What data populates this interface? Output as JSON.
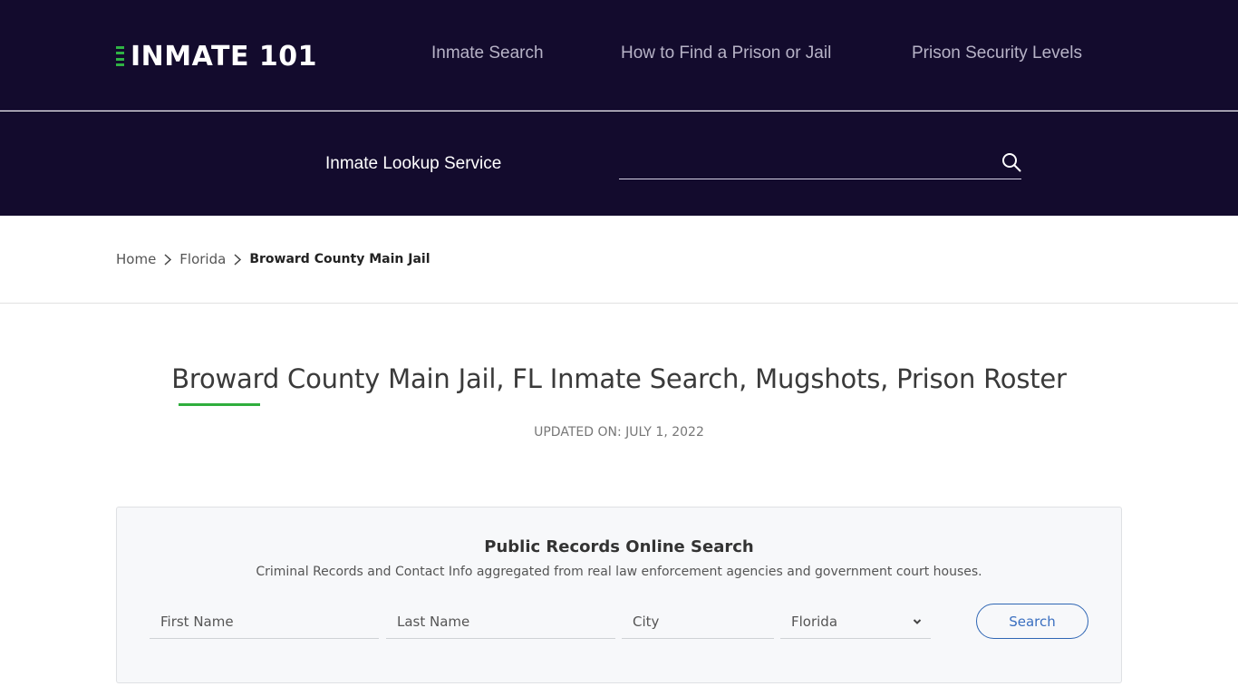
{
  "header": {
    "logo_text": "INMATE 101",
    "nav": [
      {
        "label": "Inmate Search"
      },
      {
        "label": "How to Find a Prison or Jail"
      },
      {
        "label": "Prison Security Levels"
      }
    ]
  },
  "lookup": {
    "label": "Inmate Lookup Service",
    "input_value": "",
    "input_placeholder": "",
    "search_icon": "search-icon"
  },
  "breadcrumb": {
    "items": [
      {
        "label": "Home"
      },
      {
        "label": "Florida"
      }
    ],
    "current": "Broward County Main Jail",
    "separator_icon": "chevron-right-icon"
  },
  "page": {
    "title": "Broward County Main Jail, FL Inmate Search, Mugshots, Prison Roster",
    "updated": "UPDATED ON: JULY 1, 2022"
  },
  "search_card": {
    "title": "Public Records Online Search",
    "subtitle": "Criminal Records and Contact Info aggregated from real law enforcement agencies and government court houses.",
    "fields": {
      "first_name_placeholder": "First Name",
      "last_name_placeholder": "Last Name",
      "city_placeholder": "City",
      "state_selected": "Florida"
    },
    "button_label": "Search"
  },
  "colors": {
    "header_bg": "#130b2d",
    "accent_green": "#2fae3d",
    "button_blue": "#2f66b4"
  }
}
